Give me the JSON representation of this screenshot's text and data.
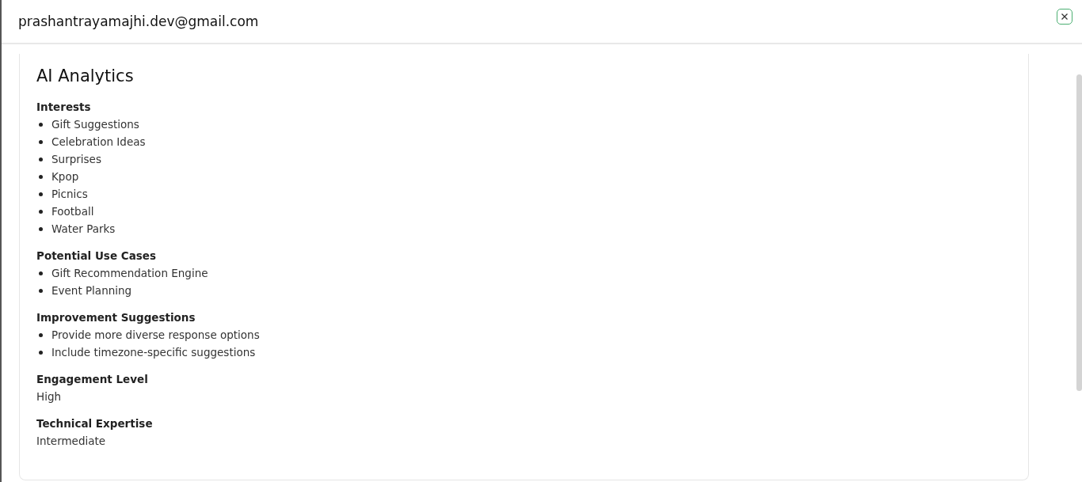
{
  "dialog": {
    "title": "prashantrayamajhi.dev@gmail.com"
  },
  "card": {
    "title": "AI Analytics",
    "sections": [
      {
        "kind": "list",
        "heading": "Interests",
        "items": [
          "Gift Suggestions",
          "Celebration Ideas",
          "Surprises",
          "Kpop",
          "Picnics",
          "Football",
          "Water Parks"
        ]
      },
      {
        "kind": "list",
        "heading": "Potential Use Cases",
        "items": [
          "Gift Recommendation Engine",
          "Event Planning"
        ]
      },
      {
        "kind": "list",
        "heading": "Improvement Suggestions",
        "items": [
          "Provide more diverse response options",
          "Include timezone-specific suggestions"
        ]
      },
      {
        "kind": "text",
        "heading": "Engagement Level",
        "value": "High"
      },
      {
        "kind": "text",
        "heading": "Technical Expertise",
        "value": "Intermediate"
      }
    ]
  }
}
